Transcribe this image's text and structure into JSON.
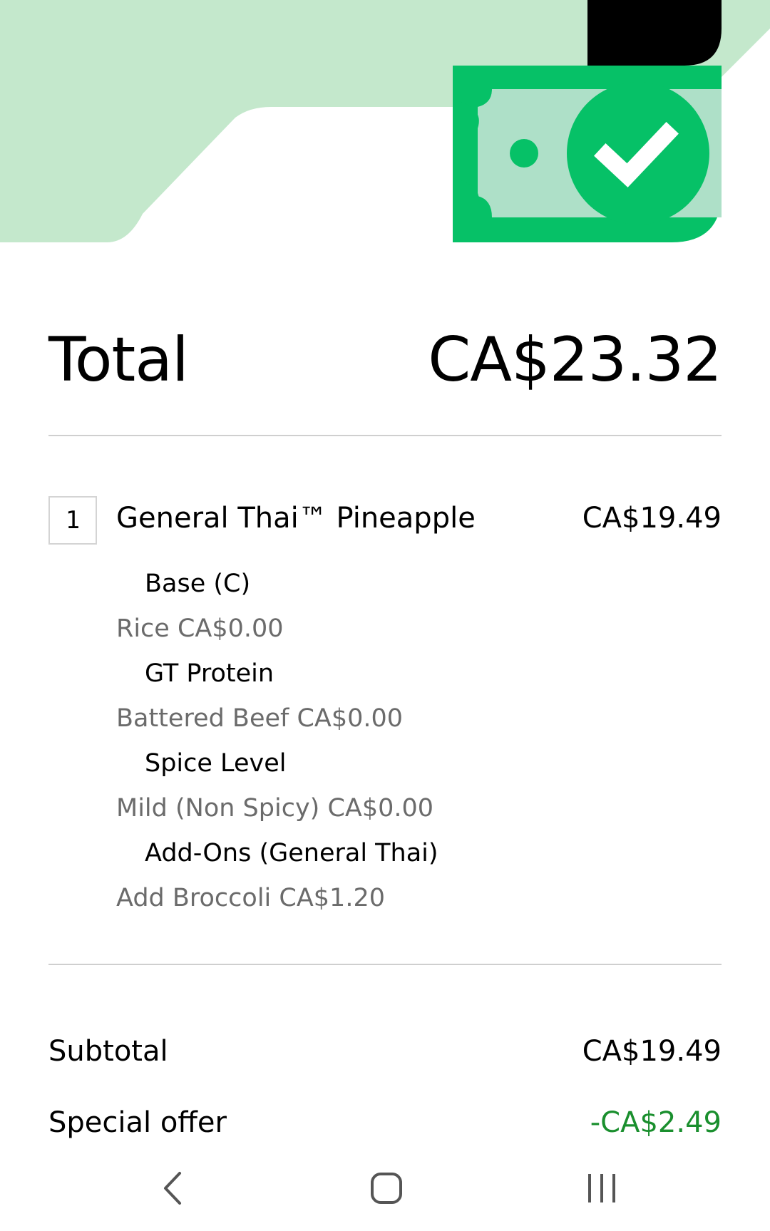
{
  "colors": {
    "hero_bg": "#c4e8cc",
    "brand_green": "#06c167",
    "note_light": "#aee0c8",
    "black": "#000000",
    "offer_green": "#1a8f2e",
    "muted_text": "#6b6b6b"
  },
  "hero": {
    "icon": "cash-check-icon"
  },
  "total": {
    "label": "Total",
    "amount": "CA$23.32"
  },
  "item": {
    "quantity": "1",
    "name": "General Thai™ Pineapple",
    "price": "CA$19.49",
    "options": [
      {
        "group": "Base (C)",
        "value": "Rice CA$0.00"
      },
      {
        "group": "GT Protein",
        "value": "Battered Beef CA$0.00"
      },
      {
        "group": "Spice Level",
        "value": "Mild (Non Spicy) CA$0.00"
      },
      {
        "group": "Add-Ons (General Thai)",
        "value": "Add Broccoli CA$1.20"
      }
    ]
  },
  "summary": {
    "subtotal_label": "Subtotal",
    "subtotal_amount": "CA$19.49",
    "offer_label": "Special offer",
    "offer_amount": "-CA$2.49"
  },
  "navbar": {
    "back_icon": "back-icon",
    "home_icon": "home-icon",
    "recents_icon": "recents-icon"
  }
}
